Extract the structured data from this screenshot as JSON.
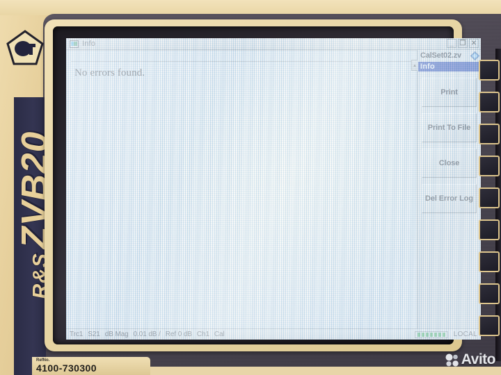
{
  "device": {
    "brand": "R&S",
    "model": "ZVB20",
    "brand_full": "R&S ZVB20",
    "cert_mark": "gost-metrology-icon",
    "nameplate_label": "RefNo.",
    "nameplate_value": "4100-730300",
    "bezel_color": "#e6cf9b",
    "chassis_color": "#4b4651",
    "stripe_color": "#2e2f4b"
  },
  "window": {
    "title": "Info",
    "icon": "display-monitor-icon",
    "minimize_label": "_",
    "restore_label": "❐",
    "close_label": "✕"
  },
  "document": {
    "message": "No errors found."
  },
  "sidebar": {
    "tab_glyph": "▴",
    "calset_name": "CalSet02.zv",
    "calset_icon": "blue-diamond-icon",
    "section_header": "Info",
    "header_color": "#0b2aa8",
    "buttons": [
      {
        "label": "Print"
      },
      {
        "label": "Print To File"
      },
      {
        "label": "Close"
      },
      {
        "label": "Del Error Log"
      }
    ]
  },
  "statusbar": {
    "fields": [
      "Trc1",
      "S21",
      "dB Mag",
      "0.01 dB /",
      "Ref 0 dB",
      "Ch1",
      "Cal"
    ],
    "led_count": 7,
    "led_color": "#1f9e3d",
    "mode": "LOCAL"
  },
  "watermark": {
    "text": "Avito",
    "icon": "avito-dots-icon"
  }
}
